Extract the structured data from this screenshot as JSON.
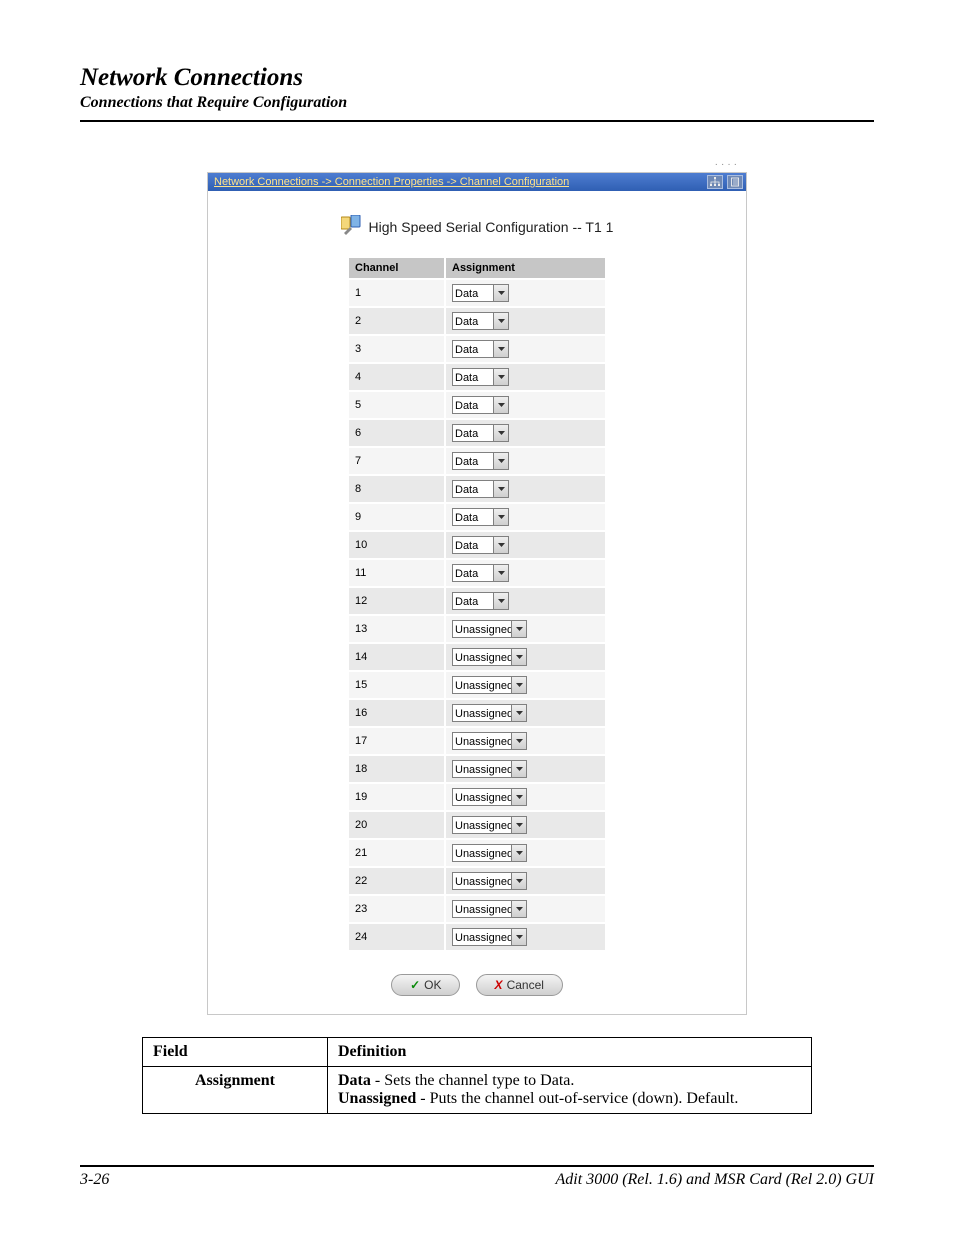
{
  "header": {
    "title": "Network Connections",
    "subtitle": "Connections that Require Configuration"
  },
  "window": {
    "breadcrumb": "Network Connections -> Connection Properties -> Channel Configuration",
    "panel_title": "High Speed Serial Configuration -- T1  1",
    "columns": {
      "channel": "Channel",
      "assignment": "Assignment"
    },
    "rows": [
      {
        "channel": "1",
        "assignment": "Data"
      },
      {
        "channel": "2",
        "assignment": "Data"
      },
      {
        "channel": "3",
        "assignment": "Data"
      },
      {
        "channel": "4",
        "assignment": "Data"
      },
      {
        "channel": "5",
        "assignment": "Data"
      },
      {
        "channel": "6",
        "assignment": "Data"
      },
      {
        "channel": "7",
        "assignment": "Data"
      },
      {
        "channel": "8",
        "assignment": "Data"
      },
      {
        "channel": "9",
        "assignment": "Data"
      },
      {
        "channel": "10",
        "assignment": "Data"
      },
      {
        "channel": "11",
        "assignment": "Data"
      },
      {
        "channel": "12",
        "assignment": "Data"
      },
      {
        "channel": "13",
        "assignment": "Unassigned"
      },
      {
        "channel": "14",
        "assignment": "Unassigned"
      },
      {
        "channel": "15",
        "assignment": "Unassigned"
      },
      {
        "channel": "16",
        "assignment": "Unassigned"
      },
      {
        "channel": "17",
        "assignment": "Unassigned"
      },
      {
        "channel": "18",
        "assignment": "Unassigned"
      },
      {
        "channel": "19",
        "assignment": "Unassigned"
      },
      {
        "channel": "20",
        "assignment": "Unassigned"
      },
      {
        "channel": "21",
        "assignment": "Unassigned"
      },
      {
        "channel": "22",
        "assignment": "Unassigned"
      },
      {
        "channel": "23",
        "assignment": "Unassigned"
      },
      {
        "channel": "24",
        "assignment": "Unassigned"
      }
    ],
    "buttons": {
      "ok": "OK",
      "cancel": "Cancel"
    }
  },
  "definition_table": {
    "headers": {
      "field": "Field",
      "definition": "Definition"
    },
    "row": {
      "field": "Assignment",
      "definition": {
        "data_label": "Data",
        "data_text": " - Sets the channel type to Data.",
        "unassigned_label": "Unassigned",
        "unassigned_text": " - Puts the channel out-of-service (down). Default."
      }
    }
  },
  "footer": {
    "page": "3-26",
    "doc": "Adit 3000 (Rel. 1.6) and MSR Card (Rel 2.0) GUI"
  }
}
